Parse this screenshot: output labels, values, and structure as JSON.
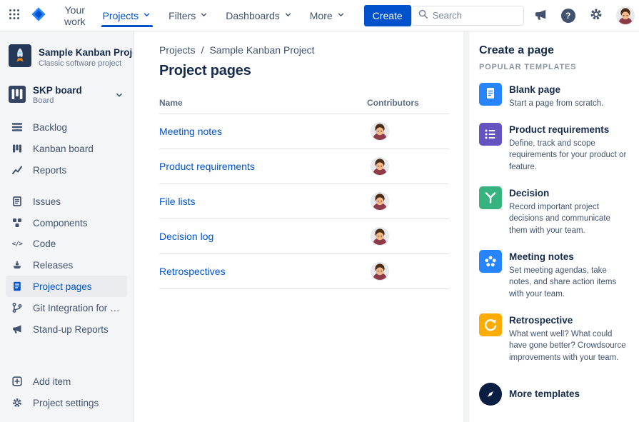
{
  "topbar": {
    "nav": [
      {
        "label": "Your work",
        "chevron": false,
        "active": false
      },
      {
        "label": "Projects",
        "chevron": true,
        "active": true
      },
      {
        "label": "Filters",
        "chevron": true,
        "active": false
      },
      {
        "label": "Dashboards",
        "chevron": true,
        "active": false
      },
      {
        "label": "More",
        "chevron": true,
        "active": false
      }
    ],
    "create_label": "Create",
    "search_placeholder": "Search"
  },
  "icons": {
    "help_glyph": "?",
    "code_glyph": "</>"
  },
  "sidebar": {
    "project": {
      "name": "Sample Kanban Project",
      "type": "Classic software project"
    },
    "board": {
      "name": "SKP board",
      "type": "Board"
    },
    "groups": [
      {
        "items": [
          {
            "label": "Backlog",
            "icon": "backlog-icon"
          },
          {
            "label": "Kanban board",
            "icon": "kanban-icon"
          },
          {
            "label": "Reports",
            "icon": "reports-icon"
          }
        ]
      },
      {
        "items": [
          {
            "label": "Issues",
            "icon": "issues-icon"
          },
          {
            "label": "Components",
            "icon": "components-icon"
          },
          {
            "label": "Code",
            "icon": "code-icon"
          },
          {
            "label": "Releases",
            "icon": "releases-icon"
          },
          {
            "label": "Project pages",
            "icon": "pages-icon",
            "selected": true
          },
          {
            "label": "Git Integration for Jira ...",
            "icon": "git-branch-icon"
          },
          {
            "label": "Stand-up Reports",
            "icon": "standup-icon"
          }
        ]
      },
      {
        "items": [
          {
            "label": "Add item",
            "icon": "add-icon"
          },
          {
            "label": "Project settings",
            "icon": "settings-icon"
          }
        ]
      }
    ]
  },
  "main": {
    "breadcrumb": {
      "items": [
        "Projects",
        "Sample Kanban Project"
      ],
      "separator": "/"
    },
    "title": "Project pages",
    "table": {
      "columns": {
        "name": "Name",
        "contributors": "Contributors"
      },
      "rows": [
        {
          "name": "Meeting notes"
        },
        {
          "name": "Product requirements"
        },
        {
          "name": "File lists"
        },
        {
          "name": "Decision log"
        },
        {
          "name": "Retrospectives"
        }
      ]
    }
  },
  "panel": {
    "title": "Create a page",
    "subtitle": "POPULAR TEMPLATES",
    "templates": [
      {
        "name": "Blank page",
        "description": "Start a page from scratch.",
        "icon": "blank-page-icon",
        "color": "#2684FF"
      },
      {
        "name": "Product requirements",
        "description": "Define, track and scope requirements for your product or feature.",
        "icon": "product-requirements-icon",
        "color": "#6554C0"
      },
      {
        "name": "Decision",
        "description": "Record important project decisions and communicate them with your team.",
        "icon": "decision-icon",
        "color": "#36B37E"
      },
      {
        "name": "Meeting notes",
        "description": "Set meeting agendas, take notes, and share action items with your team.",
        "icon": "meeting-notes-icon",
        "color": "#2684FF"
      },
      {
        "name": "Retrospective",
        "description": "What went well? What could have gone better? Crowdsource improvements with your team.",
        "icon": "retrospective-icon",
        "color": "#FFAB00"
      }
    ],
    "more_label": "More templates"
  },
  "colors": {
    "accent": "#0052CC",
    "link": "#0052CC",
    "text": "#172B4D",
    "subtle_text": "#5E6C84",
    "sidebar_bg": "#F4F5F7",
    "selected_item_bg": "#EBECF0",
    "border": "#DFE1E6"
  }
}
